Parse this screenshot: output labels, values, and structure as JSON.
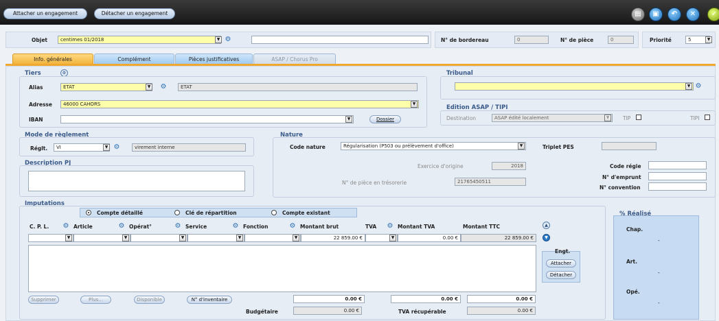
{
  "toolbar": {
    "attach_label": "Attacher un engagement",
    "detach_label": "Détacher un engagement"
  },
  "header": {
    "objet_label": "Objet",
    "objet_value": "centimes 01/2018",
    "bordereau_label": "N° de bordereau",
    "bordereau_value": "0",
    "piece_label": "N° de pièce",
    "piece_value": "0",
    "priorite_label": "Priorité",
    "priorite_value": "5"
  },
  "tabs": [
    {
      "label": "Info. générales"
    },
    {
      "label": "Complément"
    },
    {
      "label": "Pièces justificatives"
    },
    {
      "label": "ASAP / Chorus Pro"
    }
  ],
  "tiers": {
    "title": "Tiers",
    "alias_label": "Alias",
    "alias_value": "ETAT",
    "alias_name": "ETAT",
    "adresse_label": "Adresse",
    "adresse_value": "46000 CAHORS",
    "iban_label": "IBAN",
    "dossier_label": "Dossier"
  },
  "tribunal": {
    "title": "Tribunal"
  },
  "edition": {
    "title": "Edition ASAP / TIPI",
    "destination_label": "Destination",
    "destination_value": "ASAP édité localement",
    "tip_label": "TIP",
    "tipi_label": "TIPI"
  },
  "reglement": {
    "title": "Mode de règlement",
    "reglt_label": "Réglt.",
    "reglt_code": "VI",
    "reglt_value": "virement interne"
  },
  "nature": {
    "title": "Nature",
    "code_label": "Code nature",
    "code_value": "Régularisation (P503 ou prélèvement d'office)",
    "triplet_label": "Triplet PES",
    "exercice_label": "Exercice d'origine",
    "exercice_value": "2018",
    "piece_tresorerie_label": "N° de pièce en trésorerie",
    "piece_tresorerie_value": "21765450511",
    "code_regie_label": "Code régie",
    "emprunt_label": "N° d'emprunt",
    "convention_label": "N° convention"
  },
  "description": {
    "title": "Description PJ"
  },
  "imputations": {
    "title": "Imputations",
    "radio_options": [
      "Compte détaillé",
      "Clé de répartition",
      "Compte existant"
    ],
    "columns": {
      "cpl": "C. P. L.",
      "article": "Article",
      "operat": "Opérat°",
      "service": "Service",
      "fonction": "Fonction",
      "montant_brut": "Montant brut",
      "tva": "TVA",
      "montant_tva": "Montant TVA",
      "montant_ttc": "Montant TTC"
    },
    "row": {
      "montant_brut": "22 859.00 €",
      "montant_tva": "0.00 €",
      "montant_ttc": "22 859.00 €"
    },
    "engt_title": "Engt.",
    "attacher_label": "Attacher",
    "detacher_label": "Détacher",
    "buttons": {
      "supprimer": "Supprimer",
      "plus": "Plus...",
      "disponible": "Disponible",
      "inventaire": "N° d'inventaire"
    },
    "totals": {
      "brut": "0.00 €",
      "tva": "0.00 €",
      "ttc": "0.00 €"
    },
    "budgetaire_label": "Budgétaire",
    "budgetaire_value": "0.00 €",
    "tva_recup_label": "TVA récupérable",
    "tva_recup_value": "0.00 €"
  },
  "realise": {
    "title": "% Réalisé",
    "chap_label": "Chap.",
    "chap_value": "-",
    "art_label": "Art.",
    "art_value": "-",
    "ope_label": "Opé.",
    "ope_value": "-"
  }
}
